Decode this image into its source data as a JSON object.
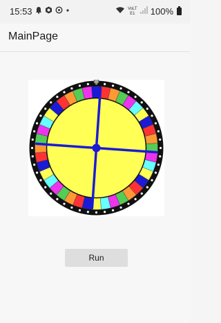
{
  "status_bar": {
    "time": "15:53",
    "left_icons": [
      "alarm-icon",
      "settings-icon",
      "sync-icon",
      "dot-icon"
    ],
    "network_label": "VoLTE1",
    "battery_percent": "100%",
    "right_icons": [
      "wifi-icon",
      "signal-icon",
      "battery-icon"
    ]
  },
  "app_bar": {
    "title": "MainPage"
  },
  "wheel": {
    "segment_colors": [
      "#1b1bd6",
      "#ff3333",
      "#ff9933",
      "#55cc55",
      "#ee33ee",
      "#66ffff",
      "#ffff55"
    ],
    "segment_count": 40,
    "hub_color": "#ffff55",
    "spoke_color": "#1b1bd6",
    "rim_color": "#111111",
    "dot_color": "#ffffff",
    "dot_count": 48,
    "spoke_count": 4
  },
  "actions": {
    "run_label": "Run"
  }
}
